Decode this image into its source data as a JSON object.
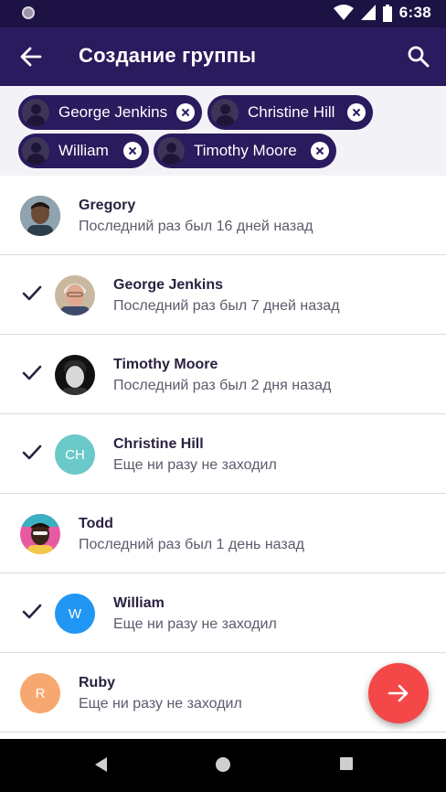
{
  "status_bar": {
    "time": "6:38"
  },
  "app_bar": {
    "title": "Создание группы"
  },
  "chips": [
    {
      "name": "George Jenkins"
    },
    {
      "name": "Christine Hill"
    },
    {
      "name": "William"
    },
    {
      "name": "Timothy Moore"
    }
  ],
  "contacts": [
    {
      "name": "Gregory",
      "status": "Последний раз был 16 дней назад",
      "selected": false,
      "avatar": "photo"
    },
    {
      "name": "George Jenkins",
      "status": "Последний раз был 7 дней назад",
      "selected": true,
      "avatar": "photo"
    },
    {
      "name": "Timothy Moore",
      "status": "Последний раз был 2 дня назад",
      "selected": true,
      "avatar": "photo"
    },
    {
      "name": "Christine Hill",
      "status": "Еще ни разу не заходил",
      "selected": true,
      "avatar_initials": "CH",
      "avatar_color": "#6cc9c9"
    },
    {
      "name": "Todd",
      "status": "Последний раз был 1 день назад",
      "selected": false,
      "avatar": "photo"
    },
    {
      "name": "William",
      "status": "Еще ни разу не заходил",
      "selected": true,
      "avatar_initials": "W",
      "avatar_color": "#2196f3"
    },
    {
      "name": "Ruby",
      "status": "Еще ни разу не заходил",
      "selected": false,
      "avatar_initials": "R",
      "avatar_color": "#f7a870"
    }
  ],
  "colors": {
    "status_bar": "#1c1243",
    "app_bar": "#2a1a5e",
    "fab": "#f44848"
  }
}
